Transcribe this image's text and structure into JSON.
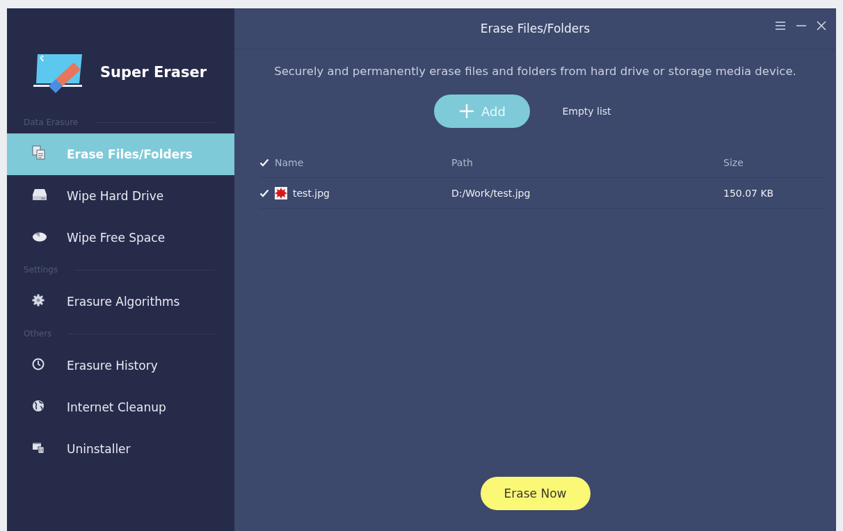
{
  "app": {
    "name": "Super Eraser"
  },
  "sidebar": {
    "sections": [
      {
        "heading": "Data Erasure",
        "items": [
          {
            "label": "Erase Files/Folders",
            "selected": true
          },
          {
            "label": "Wipe Hard Drive",
            "selected": false
          },
          {
            "label": "Wipe Free Space",
            "selected": false
          }
        ]
      },
      {
        "heading": "Settings",
        "items": [
          {
            "label": "Erasure Algorithms",
            "selected": false
          }
        ]
      },
      {
        "heading": "Others",
        "items": [
          {
            "label": "Erasure History",
            "selected": false
          },
          {
            "label": "Internet Cleanup",
            "selected": false
          },
          {
            "label": "Uninstaller",
            "selected": false
          }
        ]
      }
    ]
  },
  "window": {
    "title": "Erase Files/Folders"
  },
  "description": "Securely and permanently erase files and folders from hard drive or storage media device.",
  "add_button": "Add",
  "empty_list_button": "Empty list",
  "table": {
    "select_all_checked": true,
    "columns": [
      "Name",
      "Path",
      "Size"
    ],
    "rows": [
      {
        "checked": true,
        "name": "test.jpg",
        "path": "D:/Work/test.jpg",
        "size": "150.07 KB"
      }
    ]
  },
  "erase_button": "Erase Now"
}
